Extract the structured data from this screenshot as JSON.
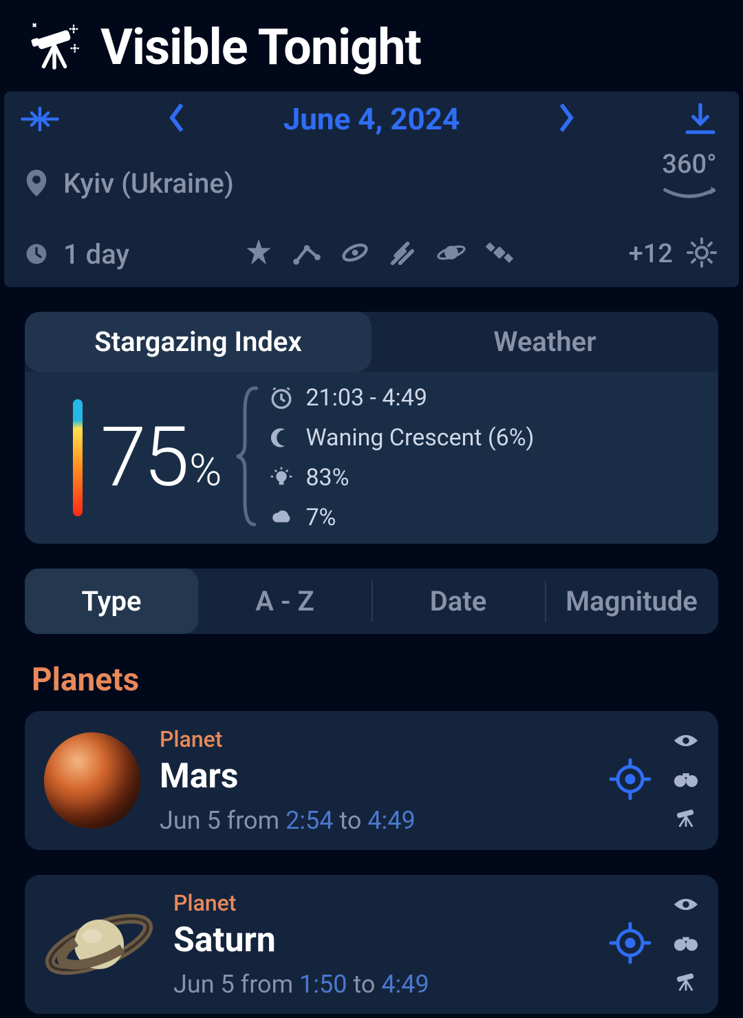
{
  "header": {
    "title": "Visible Tonight"
  },
  "date_bar": {
    "date": "June 4, 2024"
  },
  "location": {
    "name": "Kyiv (Ukraine)",
    "pano_label": "360°"
  },
  "filters": {
    "period": "1 day",
    "extra_count": "+12"
  },
  "index": {
    "tabs": [
      "Stargazing Index",
      "Weather"
    ],
    "active_tab": 0,
    "value": "75",
    "percent": "%",
    "dark_window": "21:03 - 4:49",
    "moon": "Waning Crescent (6%)",
    "light": "83%",
    "cloud": "7%"
  },
  "sort": {
    "tabs": [
      "Type",
      "A - Z",
      "Date",
      "Magnitude"
    ],
    "active": 0
  },
  "section": {
    "title": "Planets"
  },
  "objects": [
    {
      "kind": "mars",
      "type_label": "Planet",
      "name": "Mars",
      "date_prefix": "Jun 5 from ",
      "t1": "2:54",
      "mid": " to ",
      "t2": "4:49"
    },
    {
      "kind": "saturn",
      "type_label": "Planet",
      "name": "Saturn",
      "date_prefix": "Jun 5 from ",
      "t1": "1:50",
      "mid": " to ",
      "t2": "4:49"
    }
  ]
}
